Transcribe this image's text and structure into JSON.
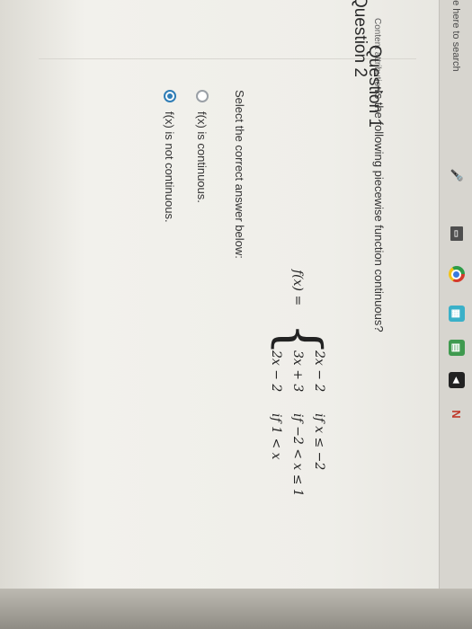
{
  "taskbar": {
    "search_text": "pe here to search",
    "icons": [
      "microphone-icon",
      "task-view-icon",
      "chrome-icon",
      "store-icon",
      "media-icon",
      "file-explorer-icon",
      "app-icon"
    ]
  },
  "content_attribution": "Content attribution",
  "question1": {
    "heading": "Question 1",
    "prompt": "Is the following piecewise function continuous?",
    "function": {
      "label": "f(x) =",
      "cases": [
        {
          "expr": "2x − 2",
          "cond": "if  x ≤ −2"
        },
        {
          "expr": "3x + 3",
          "cond": "if  −2 < x ≤ 1"
        },
        {
          "expr": "2x − 2",
          "cond": "if  1 < x"
        }
      ]
    },
    "instruction": "Select the correct answer below:",
    "options": [
      {
        "label": "f(x) is continuous.",
        "selected": false
      },
      {
        "label": "f(x) is not continuous.",
        "selected": true
      }
    ]
  },
  "question2": {
    "heading": "Question 2"
  },
  "colors": {
    "accent": "#2f7db6",
    "text": "#333333",
    "page_background": "#efeee9"
  }
}
